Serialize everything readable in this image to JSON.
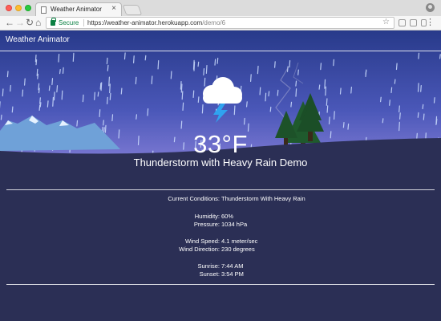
{
  "browser": {
    "tab_title": "Weather Animator",
    "tab_close": "×",
    "secure_label": "Secure",
    "url_host": "https://weather-animator.herokuapp.com",
    "url_path": "/demo/6",
    "back": "←",
    "forward": "→",
    "reload": "↻",
    "home": "⌂",
    "star": "☆",
    "menu": "⋮"
  },
  "app": {
    "title": "Weather Animator",
    "temperature": "33°F",
    "summary": "Thunderstorm with Heavy Rain Demo",
    "icon": "thunderstorm-cloud-icon"
  },
  "conditions": [
    {
      "label": "Current Conditions:",
      "value": "Thunderstorm With Heavy Rain"
    },
    {
      "label": "Humidity:",
      "value": "60%"
    },
    {
      "label": "Pressure:",
      "value": "1034 hPa"
    },
    {
      "label": "Wind Speed:",
      "value": "4.1 meter/sec"
    },
    {
      "label": "Wind Direction:",
      "value": "230 degrees"
    },
    {
      "label": "Sunrise:",
      "value": "7:44 AM"
    },
    {
      "label": "Sunset:",
      "value": "3:54 PM"
    }
  ],
  "colors": {
    "sky_top": "#2c3a86",
    "sky_bottom": "#7f79d6",
    "ground": "#2b2f55",
    "mountain": "#6f9fd6",
    "tree": "#1f5a2d",
    "bolt": "#2fa3f0"
  }
}
